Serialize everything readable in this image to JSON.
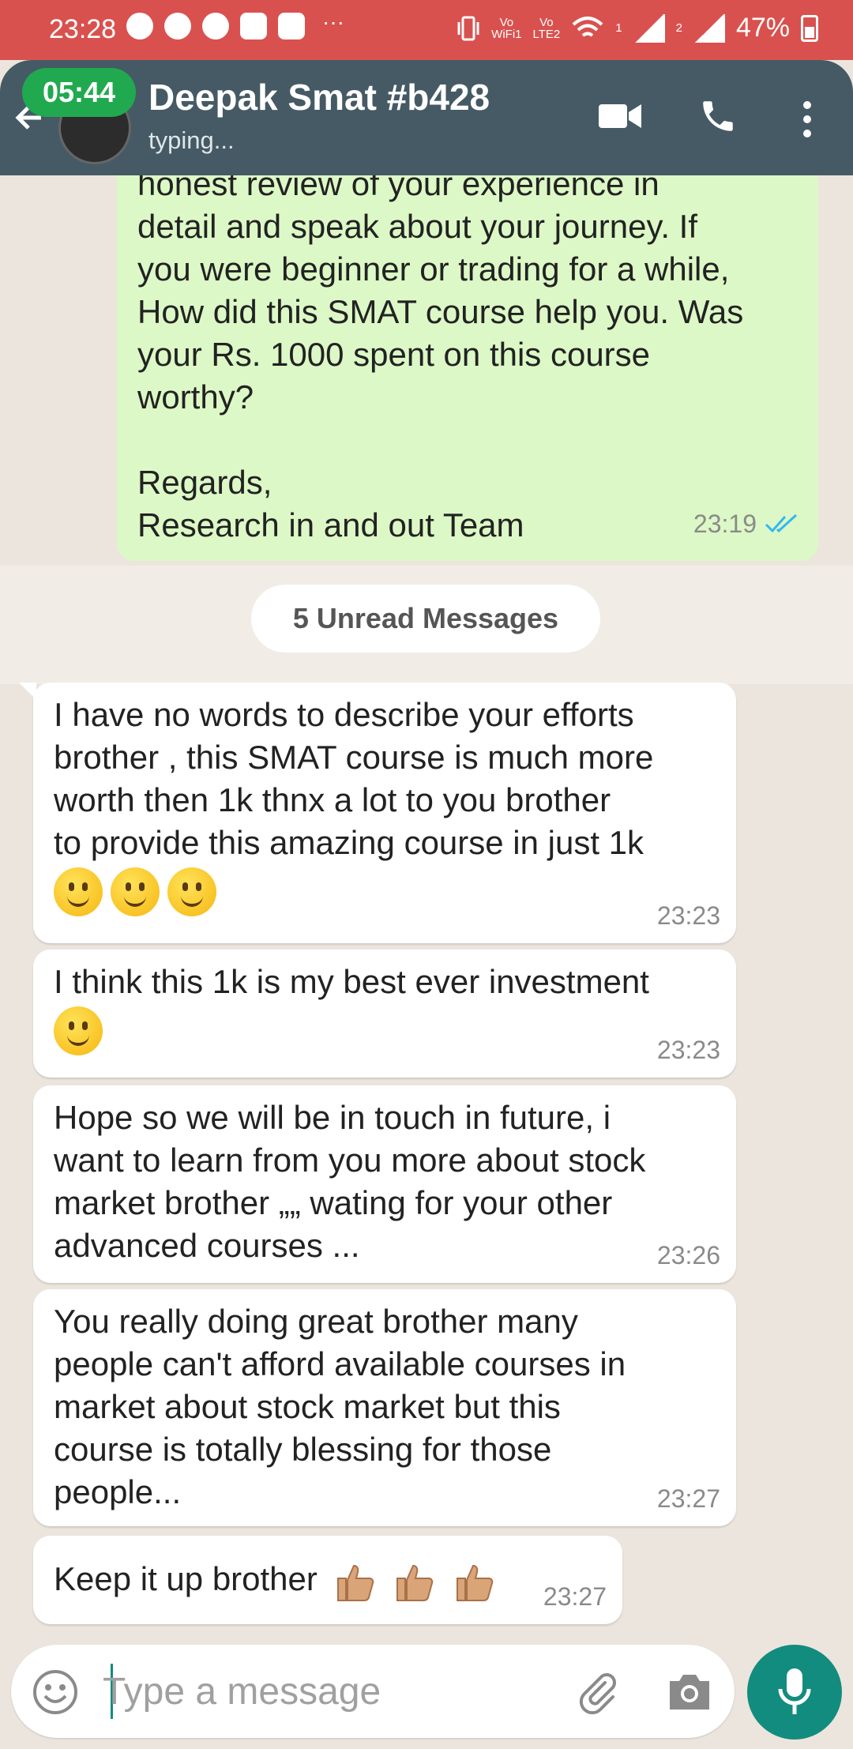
{
  "status_bar": {
    "time": "23:28",
    "more": "···",
    "vo1_line1": "Vo",
    "vo1_line2": "WiFi1",
    "vo2_line1": "Vo",
    "vo2_line2": "LTE2",
    "sim1": "1",
    "sim2": "2",
    "battery": "47%"
  },
  "header": {
    "call_timer": "05:44",
    "contact_name": "Deepak Smat #b428",
    "contact_status": "typing..."
  },
  "outgoing": {
    "text": "honest review of your experience in\ndetail and speak about your journey. If\nyou were beginner or trading for a while,\nHow did this SMAT course help you. Was\nyour Rs. 1000 spent on this course\nworthy?\n\nRegards,\nResearch in and out Team",
    "time": "23:19"
  },
  "unread_label": "5 Unread Messages",
  "incoming": [
    {
      "text": "I have no words to describe your efforts\nbrother , this SMAT course is much more\nworth then 1k   thnx a lot to you brother\nto provide this amazing course in just 1k",
      "time": "23:23"
    },
    {
      "text": "I think this 1k is my best ever investment",
      "time": "23:23"
    },
    {
      "text": "Hope so we will be in touch in  future, i\nwant to learn from you more about stock\nmarket brother    „„ wating for your other\nadvanced courses ...",
      "time": "23:26"
    },
    {
      "text": "You really doing great brother  many\npeople can't afford available courses in\nmarket about stock market   but this\ncourse is totally blessing for those\npeople...",
      "time": "23:27"
    },
    {
      "text": "Keep it up brother",
      "time": "23:27"
    }
  ],
  "composer": {
    "placeholder": "Type a message"
  },
  "colors": {
    "header": "#455a64",
    "status_bar": "#d9514e",
    "outgoing_bubble": "#dcf8c6",
    "accent": "#128c7e",
    "call_pill": "#21a94f"
  }
}
